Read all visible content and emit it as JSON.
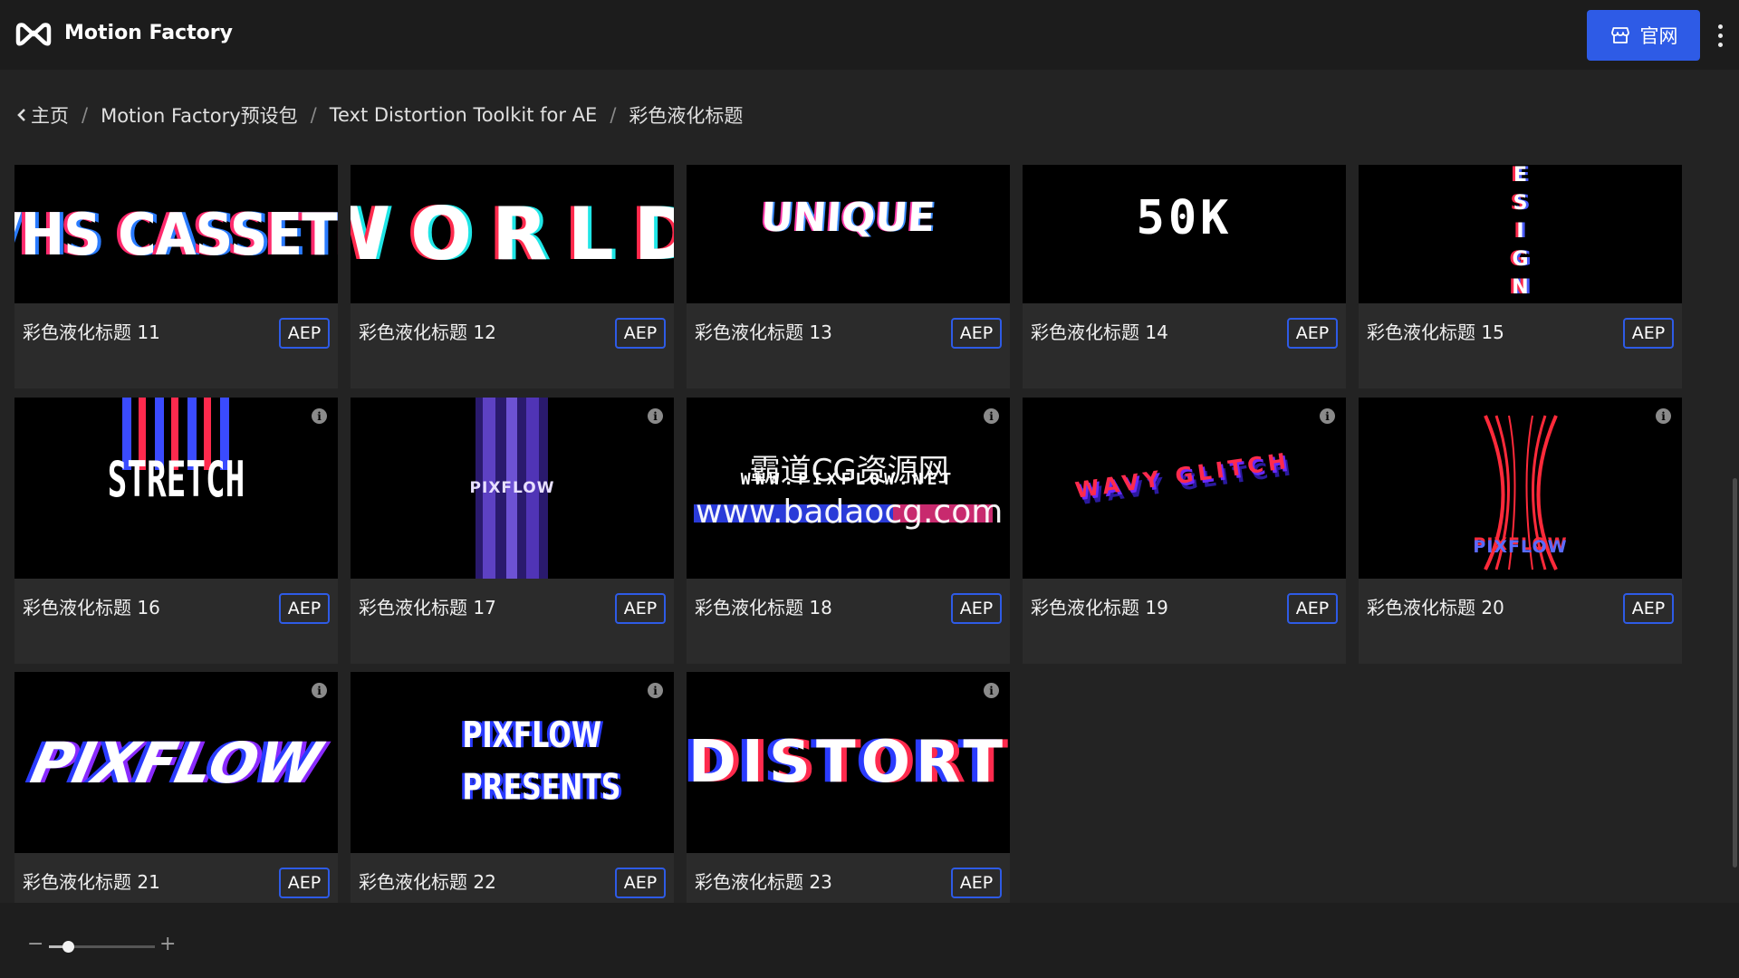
{
  "header": {
    "app_title": "Motion Factory",
    "official_button_label": "官网"
  },
  "breadcrumb": {
    "items": [
      "主页",
      "Motion Factory预设包",
      "Text Distortion Toolkit for AE",
      "彩色液化标题"
    ],
    "separator": "/"
  },
  "cards": [
    {
      "title": "彩色液化标题 11",
      "tag": "AEP",
      "preview": "VHS CASSETE",
      "info": false
    },
    {
      "title": "彩色液化标题 12",
      "tag": "AEP",
      "preview": "WORLD",
      "info": false
    },
    {
      "title": "彩色液化标题 13",
      "tag": "AEP",
      "preview": "UNIQUE",
      "info": false
    },
    {
      "title": "彩色液化标题 14",
      "tag": "AEP",
      "preview": "50K",
      "info": false
    },
    {
      "title": "彩色液化标题 15",
      "tag": "AEP",
      "preview": "ESIGN",
      "info": false
    },
    {
      "title": "彩色液化标题 16",
      "tag": "AEP",
      "preview": "STRETCH",
      "info": true
    },
    {
      "title": "彩色液化标题 17",
      "tag": "AEP",
      "preview": "PIXFLOW",
      "info": true
    },
    {
      "title": "彩色液化标题 18",
      "tag": "AEP",
      "preview": "WWW.PIXFLOW.NET",
      "info": true
    },
    {
      "title": "彩色液化标题 19",
      "tag": "AEP",
      "preview": "WAVY GLITCH",
      "info": true
    },
    {
      "title": "彩色液化标题 20",
      "tag": "AEP",
      "preview": "PIXFLOW",
      "info": true
    },
    {
      "title": "彩色液化标题 21",
      "tag": "AEP",
      "preview": "PIXFLOW",
      "info": true
    },
    {
      "title": "彩色液化标题 22",
      "tag": "AEP",
      "preview": "PIXFLOW PRESENTS",
      "info": true
    },
    {
      "title": "彩色液化标题 23",
      "tag": "AEP",
      "preview": "DISTORT",
      "info": true
    }
  ],
  "watermark": {
    "line1": "霸道CG资源网",
    "line2": "www.badaocg.com"
  },
  "zoom": {
    "minus": "−",
    "plus": "+",
    "level": 0.18
  },
  "colors": {
    "accent": "#2e5be6",
    "background": "#232323",
    "topbar": "#1c1c1c",
    "card": "#2b2b2b"
  },
  "icons": {
    "logo": "motion-factory-logo-icon",
    "store": "store-icon",
    "more": "more-vertical-icon",
    "back": "chevron-left-icon",
    "info": "info-icon"
  }
}
